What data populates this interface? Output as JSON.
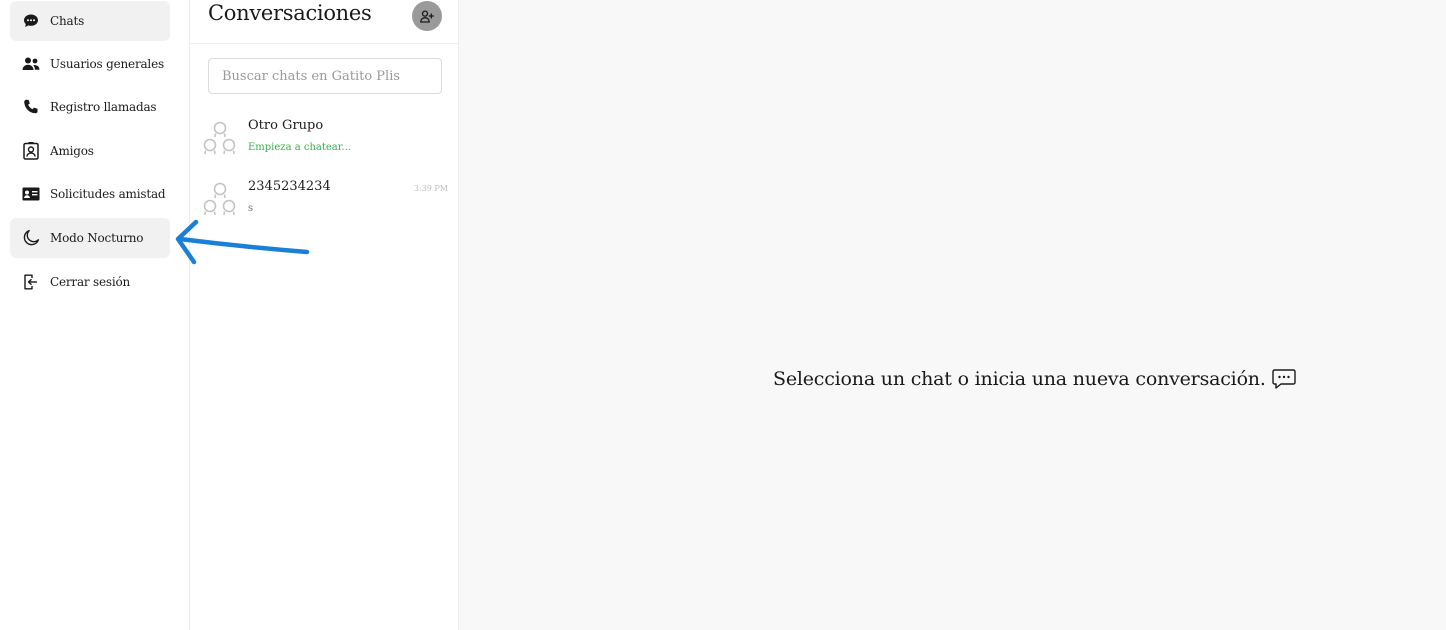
{
  "sidebar": {
    "items": [
      {
        "label": "Chats",
        "icon": "chat-bubble-icon"
      },
      {
        "label": "Usuarios generales",
        "icon": "users-icon"
      },
      {
        "label": "Registro llamadas",
        "icon": "phone-icon"
      },
      {
        "label": "Amigos",
        "icon": "contact-card-icon"
      },
      {
        "label": "Solicitudes amistad",
        "icon": "id-card-icon"
      },
      {
        "label": "Modo Nocturno",
        "icon": "moon-icon"
      },
      {
        "label": "Cerrar sesión",
        "icon": "logout-icon"
      }
    ]
  },
  "conversations": {
    "title": "Conversaciones",
    "add_icon": "add-user-icon",
    "search_placeholder": "Buscar chats en Gatito Plis",
    "chats": [
      {
        "name": "Otro Grupo",
        "preview": "Empieza a chatear...",
        "time": ""
      },
      {
        "name": "2345234234",
        "preview": "s",
        "time": "3:39 PM"
      }
    ]
  },
  "main": {
    "empty_message": "Selecciona un chat o inicia una nueva conversación.",
    "empty_icon": "chat-dots-icon"
  },
  "colors": {
    "accent_green": "#32b24a",
    "annotation_arrow": "#1a7fd6",
    "active_nav_bg": "#f1f1f1"
  }
}
